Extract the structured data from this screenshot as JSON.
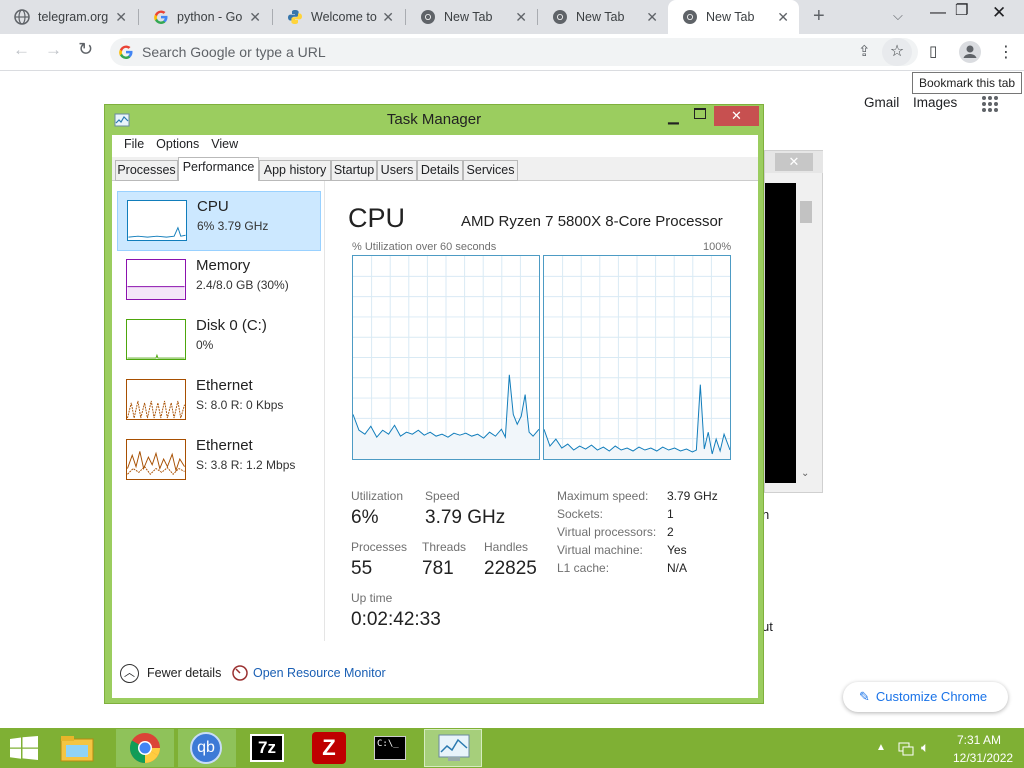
{
  "browser": {
    "tabs": [
      {
        "title": "telegram.org",
        "icon": "globe-icon"
      },
      {
        "title": "python - Go",
        "icon": "google-icon"
      },
      {
        "title": "Welcome to",
        "icon": "python-icon"
      },
      {
        "title": "New Tab",
        "icon": "chrome-icon"
      },
      {
        "title": "New Tab",
        "icon": "chrome-icon"
      },
      {
        "title": "New Tab",
        "icon": "chrome-icon"
      }
    ],
    "omnibox_placeholder": "Search Google or type a URL",
    "bookmark_tooltip": "Bookmark this tab",
    "links": {
      "gmail": "Gmail",
      "images": "Images"
    },
    "customize": "Customize Chrome",
    "bg_text_1": "n",
    "bg_text_2": "ut"
  },
  "taskmgr": {
    "title": "Task Manager",
    "menu": [
      "File",
      "Options",
      "View"
    ],
    "tabs": [
      "Processes",
      "Performance",
      "App history",
      "Startup",
      "Users",
      "Details",
      "Services"
    ],
    "sidebar": [
      {
        "name": "CPU",
        "sub": "6% 3.79 GHz",
        "color": "#117dbb"
      },
      {
        "name": "Memory",
        "sub": "2.4/8.0 GB (30%)",
        "color": "#8b12ae"
      },
      {
        "name": "Disk 0 (C:)",
        "sub": "0%",
        "color": "#4da60c"
      },
      {
        "name": "Ethernet",
        "sub": "S: 8.0  R: 0 Kbps",
        "color": "#a74f01"
      },
      {
        "name": "Ethernet",
        "sub": "S: 3.8  R: 1.2 Mbps",
        "color": "#a74f01"
      }
    ],
    "heading": "CPU",
    "processor": "AMD Ryzen 7 5800X 8-Core Processor",
    "graph_caption": "% Utilization over 60 seconds",
    "graph_max": "100%",
    "stats": {
      "utilization_label": "Utilization",
      "utilization": "6%",
      "speed_label": "Speed",
      "speed": "3.79 GHz",
      "processes_label": "Processes",
      "processes": "55",
      "threads_label": "Threads",
      "threads": "781",
      "handles_label": "Handles",
      "handles": "22825",
      "uptime_label": "Up time",
      "uptime": "0:02:42:33"
    },
    "right_stats": [
      {
        "k": "Maximum speed:",
        "v": "3.79 GHz"
      },
      {
        "k": "Sockets:",
        "v": "1"
      },
      {
        "k": "Virtual processors:",
        "v": "2"
      },
      {
        "k": "Virtual machine:",
        "v": "Yes"
      },
      {
        "k": "L1 cache:",
        "v": "N/A"
      }
    ],
    "fewer_details": "Fewer details",
    "resource_monitor": "Open Resource Monitor"
  },
  "taskbar": {
    "time": "7:31 AM",
    "date": "12/31/2022",
    "apps": [
      "start-icon",
      "file-explorer-icon",
      "chrome-icon",
      "qbittorrent-icon",
      "7zip-icon",
      "filezilla-icon",
      "cmd-icon",
      "task-manager-icon"
    ]
  }
}
